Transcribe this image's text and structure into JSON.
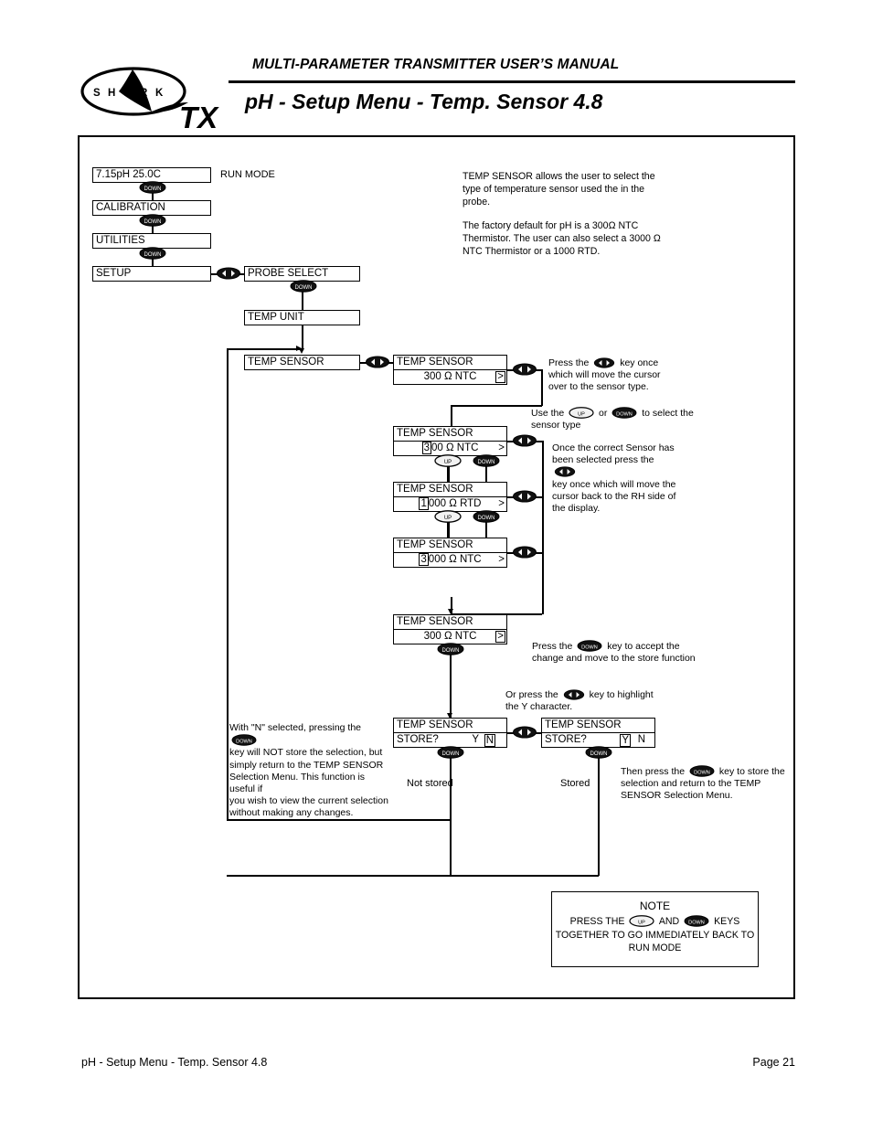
{
  "header": {
    "manual_title": "MULTI-PARAMETER TRANSMITTER USER’S MANUAL",
    "page_title": "pH - Setup Menu - Temp. Sensor 4.8",
    "logo_text_shark": "S H A R K",
    "logo_text_tx": "TX"
  },
  "footer": {
    "left": "pH - Setup Menu - Temp. Sensor 4.8",
    "right": "Page 21"
  },
  "description": {
    "para1": "TEMP SENSOR allows the user to select the type of temperature sensor used the in the probe.",
    "para2": "The factory default for pH is a 300Ω NTC Thermistor. The user can also select a 3000 Ω NTC Thermistor or a 1000 RTD."
  },
  "menu_chain": {
    "run_mode_label": "RUN MODE",
    "display": "7.15pH  25.0C",
    "calibration": "CALIBRATION",
    "utilities": "UTILITIES",
    "setup": "SETUP",
    "probe_select": "PROBE SELECT",
    "temp_unit": "TEMP UNIT",
    "temp_sensor": "TEMP SENSOR"
  },
  "screens": {
    "title": "TEMP SENSOR",
    "default_value": "300 Ω NTC",
    "store_label": "STORE?",
    "yes": "Y",
    "no": "N",
    "gt": ">",
    "options": [
      {
        "cursor": "3",
        "rest": "00 Ω NTC"
      },
      {
        "cursor": "1",
        "rest": "000 Ω RTD"
      },
      {
        "cursor": "3",
        "rest": "000 Ω NTC"
      }
    ]
  },
  "keys": {
    "up": "UP",
    "down": "DOWN",
    "leftright": "left-right"
  },
  "annotations": {
    "move_cursor": {
      "a": "Press the",
      "b": "key once",
      "c": "which will move the cursor",
      "d": "over to the sensor type."
    },
    "use_keys": {
      "a": "Use the",
      "b": "or",
      "c": "to select the",
      "d": "sensor type"
    },
    "once_correct": {
      "a": "Once the correct Sensor has",
      "b": "been selected press the",
      "c": "key once which will move the",
      "d": "cursor back to the RH side of",
      "e": "the display."
    },
    "accept_change": {
      "a": "Press the",
      "b": "key to accept the",
      "c": "change and move to the store function"
    },
    "highlight_y": {
      "a": "Or press the",
      "b": "key to highlight",
      "c": "the Y character."
    },
    "with_n": {
      "a": "With \"N\" selected, pressing the",
      "b": "key will NOT store the selection, but",
      "c": "simply return to the TEMP SENSOR",
      "d": "Selection Menu. This function is useful if",
      "e": "you wish to view the current selection",
      "f": "without making any changes."
    },
    "then_press": {
      "a": "Then press the",
      "b": "key to store the",
      "c": "selection and return to the TEMP",
      "d": "SENSOR Selection Menu."
    },
    "not_stored": "Not stored",
    "stored": "Stored"
  },
  "note": {
    "title": "NOTE",
    "l1a": "PRESS THE",
    "l1b": "AND",
    "l1c": "KEYS",
    "l2": "TOGETHER TO GO IMMEDIATELY BACK TO",
    "l3": "RUN MODE"
  }
}
